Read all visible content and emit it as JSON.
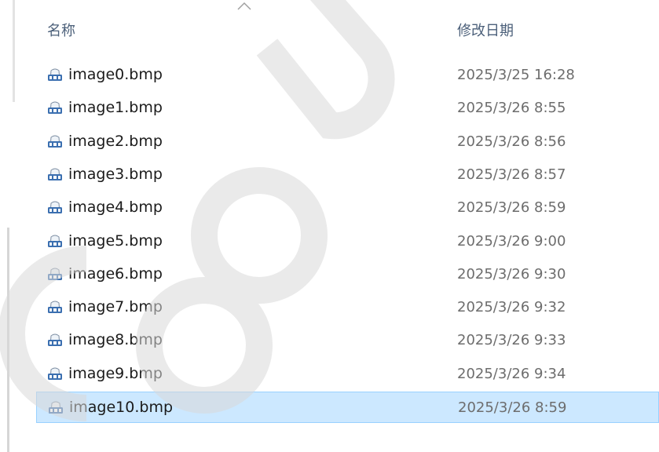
{
  "header": {
    "name_label": "名称",
    "date_label": "修改日期"
  },
  "files": [
    {
      "name": "image0.bmp",
      "date": "2025/3/25 16:28",
      "icon": "bmp-file-icon"
    },
    {
      "name": "image1.bmp",
      "date": "2025/3/26 8:55",
      "icon": "bmp-file-icon"
    },
    {
      "name": "image2.bmp",
      "date": "2025/3/26 8:56",
      "icon": "bmp-file-icon"
    },
    {
      "name": "image3.bmp",
      "date": "2025/3/26 8:57",
      "icon": "bmp-file-icon"
    },
    {
      "name": "image4.bmp",
      "date": "2025/3/26 8:59",
      "icon": "bmp-file-icon"
    },
    {
      "name": "image5.bmp",
      "date": "2025/3/26 9:00",
      "icon": "bmp-file-icon"
    },
    {
      "name": "image6.bmp",
      "date": "2025/3/26 9:30",
      "icon": "bmp-file-icon"
    },
    {
      "name": "image7.bmp",
      "date": "2025/3/26 9:32",
      "icon": "bmp-file-icon"
    },
    {
      "name": "image8.bmp",
      "date": "2025/3/26 9:33",
      "icon": "bmp-file-icon"
    },
    {
      "name": "image9.bmp",
      "date": "2025/3/26 9:34",
      "icon": "bmp-file-icon"
    },
    {
      "name": "image10.bmp",
      "date": "2025/3/26 8:59",
      "icon": "bmp-file-icon",
      "selected": true
    }
  ],
  "colors": {
    "selection_bg": "#cce8ff",
    "selection_border": "#99d1ff",
    "header_text": "#4c607a",
    "date_text": "#6d6d6d"
  }
}
